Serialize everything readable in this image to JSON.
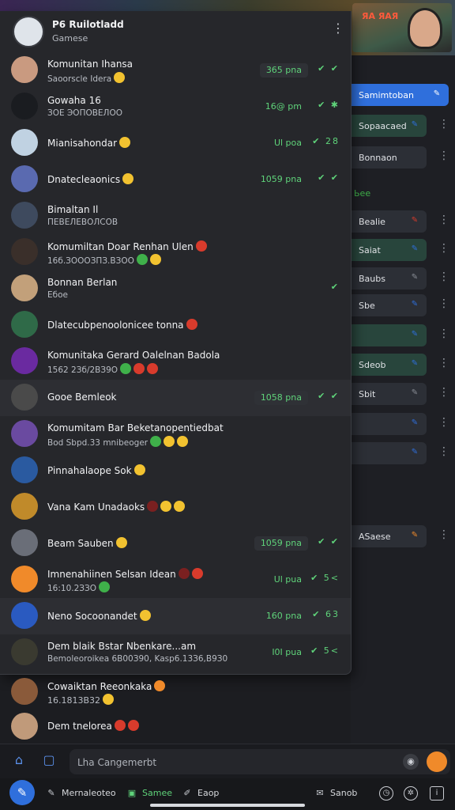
{
  "banner": {
    "thumb_text": "ЯА ЯАЯ"
  },
  "panel": {
    "header": {
      "title": "P6 Ruilotladd",
      "subtitle": "Gamese",
      "menu_icon": "more-vertical-icon"
    },
    "rows": [
      {
        "name": "Komunitan Ihansa",
        "sub": "Saoorscle Idera",
        "time": "365 pna",
        "time_boxed": true,
        "status": "✔ ✔",
        "emojis": [
          "y"
        ],
        "avatar": "#c99a80"
      },
      {
        "name": "Gowaha 16",
        "sub": "ЗОЕ ЭОПОВЕЛОО",
        "time": "16@ pm",
        "time_boxed": false,
        "status": "✔ ✱",
        "emojis": [],
        "avatar": "#1a1c20"
      },
      {
        "name": "Mianisahondar",
        "sub": "",
        "time": "Ul poa",
        "time_boxed": false,
        "status": "✔ 28",
        "emojis": [
          "y"
        ],
        "avatar": "#c0d2e2"
      },
      {
        "name": "Dnatecleaonics",
        "sub": "",
        "time": "1059 pna",
        "time_boxed": false,
        "status": "✔ ✔",
        "emojis": [
          "y"
        ],
        "avatar": "#5a6ab0"
      },
      {
        "name": "Bimaltan Il",
        "sub": "ПЕВЕЛЕВОЛСОВ",
        "time": "",
        "time_boxed": false,
        "status": "",
        "emojis": [],
        "avatar": "#3e4a5e"
      },
      {
        "name": "Komumiltan Doar Renhan Ulen",
        "sub": "16б.ЗОООЗПЗ.ВЗОО",
        "time": "",
        "time_boxed": false,
        "status": "",
        "emojis": [
          "g",
          "y"
        ],
        "name_emojis": [
          "r"
        ],
        "avatar": "#3a2f2a"
      },
      {
        "name": "Bonnan Berlan",
        "sub": "Ебое",
        "time": "",
        "time_boxed": false,
        "status": "✔",
        "emojis": [],
        "avatar": "#c2a07a"
      },
      {
        "name": "Dlatecubpenoolonicee tonna",
        "sub": "",
        "time": "",
        "time_boxed": false,
        "status": "",
        "emojis": [
          "r"
        ],
        "avatar": "#2f6a48"
      },
      {
        "name": "Komunitaka Gerard Oalelnan Badola",
        "sub": "1562 2Зб/2ВЗ9О",
        "time": "",
        "time_boxed": false,
        "status": "",
        "emojis": [
          "g",
          "r",
          "r"
        ],
        "avatar": "#6a2aa0"
      },
      {
        "name": "Gooe Bemleok",
        "sub": "",
        "time": "1058 pna",
        "time_boxed": true,
        "status": "✔ ✔",
        "emojis": [],
        "avatar": "#4a4a4a"
      },
      {
        "name": "Komumitam Bar Beketanopentiedbat",
        "sub": "Bod Sbpd.33 mnibeoger",
        "time": "",
        "time_boxed": false,
        "status": "",
        "emojis": [
          "g",
          "y",
          "y"
        ],
        "avatar": "#6a4aa0"
      },
      {
        "name": "Pinnahalaope Sok",
        "sub": "",
        "time": "",
        "time_boxed": false,
        "status": "",
        "emojis": [
          "y"
        ],
        "avatar": "#2a5aa0"
      },
      {
        "name": "Vana Kam Unadaoks",
        "sub": "",
        "time": "",
        "time_boxed": false,
        "status": "",
        "emojis": [
          "d",
          "y",
          "y"
        ],
        "avatar": "#c08a2a"
      },
      {
        "name": "Beam Sauben",
        "sub": "",
        "time": "1059 pna",
        "time_boxed": true,
        "status": "✔ ✔",
        "emojis": [
          "y"
        ],
        "avatar": "#6a6e78"
      },
      {
        "name": "Imnenahiinen Selsan Idean",
        "sub": "16:10.2ЗЗО",
        "time": "Ul pua",
        "time_boxed": false,
        "status": "✔ 5<",
        "emojis": [
          "g"
        ],
        "name_emojis": [
          "d",
          "r"
        ],
        "avatar": "#f08a2a"
      },
      {
        "name": "Neno Socoonandet",
        "sub": "",
        "time": "160 pna",
        "time_boxed": false,
        "status": "✔ 63",
        "emojis": [
          "y"
        ],
        "avatar": "#2a5ac0"
      },
      {
        "name": "Dem blaik Bstar Nbenkare...am",
        "sub": "Bemoleoroikea 6В00З90, Kasp6.13З6,В9З0",
        "time": "I0I pua",
        "time_boxed": false,
        "status": "✔ 5<",
        "emojis": [],
        "avatar": "#3a3a30"
      }
    ]
  },
  "under_rows": [
    {
      "name": "Cowaiktan Reeonkaka",
      "sub": "16.1813В32",
      "emojis": [
        "y"
      ],
      "name_emojis": [
        "o"
      ],
      "avatar": "#8a5a3a"
    },
    {
      "name": "Dem tnelorea",
      "sub": "",
      "emojis": [
        "r",
        "r"
      ],
      "avatar": "#c09a7a"
    }
  ],
  "right_rows": [
    {
      "label": "Samimtoban",
      "style": "blue",
      "icon_color": "#ffffff"
    },
    {
      "label": "Sopaacaed",
      "style": "green",
      "icon_color": "#2f6fdc"
    },
    {
      "label": "Bonnaon",
      "style": "plain",
      "icon_color": ""
    },
    {
      "label": "Ьее",
      "style": "none",
      "icon_color": "#3fb04a"
    },
    {
      "label": "Bealie",
      "style": "plain",
      "icon_color": "#d83b2c"
    },
    {
      "label": "Saiat",
      "style": "green",
      "icon_color": "#2f6fdc"
    },
    {
      "label": "Baubs",
      "style": "plain",
      "icon_color": "#8a8e96"
    },
    {
      "label": "Sbe",
      "style": "plain",
      "icon_color": "#2f6fdc"
    },
    {
      "label": "",
      "style": "green",
      "icon_color": "#2f6fdc"
    },
    {
      "label": "Sdeob",
      "style": "green",
      "icon_color": "#2f6fdc"
    },
    {
      "label": "Sbit",
      "style": "plain",
      "icon_color": "#8a8e96"
    },
    {
      "label": "",
      "style": "plain",
      "icon_color": "#2f6fdc"
    },
    {
      "label": "",
      "style": "plain",
      "icon_color": "#2f6fdc"
    },
    {
      "label": "ASaese",
      "style": "plain",
      "icon_color": "#f08a2a"
    }
  ],
  "composer": {
    "placeholder": "Lha Cangemerbt"
  },
  "nav": {
    "items": [
      {
        "label": "Mernaleoteo",
        "glyph": "✎",
        "active": false
      },
      {
        "label": "Samee",
        "glyph": "▣",
        "active": true
      },
      {
        "label": "Eaop",
        "glyph": "✐",
        "active": false
      },
      {
        "label": "Sanob",
        "glyph": "✉",
        "active": false
      }
    ]
  },
  "colors": {
    "accent": "#2f6fdc",
    "online_green": "#5fd37a",
    "panel": "#26272b"
  }
}
